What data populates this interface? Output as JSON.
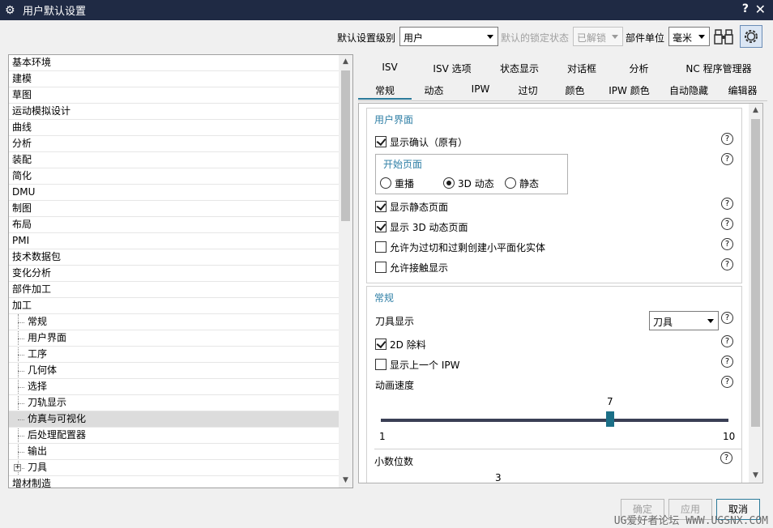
{
  "window": {
    "title": "用户默认设置",
    "help": "?",
    "close": "✕"
  },
  "toolbar": {
    "level_label": "默认设置级别",
    "level_value": "用户",
    "lock_label": "默认的锁定状态",
    "lock_value": "已解锁",
    "unit_label": "部件单位",
    "unit_value": "毫米"
  },
  "tree": {
    "items": [
      "基本环境",
      "建模",
      "草图",
      "运动模拟设计",
      "曲线",
      "分析",
      "装配",
      "简化",
      "DMU",
      "制图",
      "布局",
      "PMI",
      "技术数据包",
      "变化分析",
      "部件加工",
      "加工"
    ],
    "children": [
      "常规",
      "用户界面",
      "工序",
      "几何体",
      "选择",
      "刀轨显示",
      "仿真与可视化",
      "后处理配置器",
      "输出",
      "刀具"
    ],
    "after": [
      "增材制造"
    ],
    "selected": "仿真与可视化"
  },
  "tabs": {
    "row1": [
      "ISV",
      "ISV 选项",
      "状态显示",
      "对话框",
      "分析",
      "NC 程序管理器"
    ],
    "row2": [
      "常规",
      "动态",
      "IPW",
      "过切",
      "颜色",
      "IPW 颜色",
      "自动隐藏",
      "编辑器"
    ],
    "active": "常规"
  },
  "ui_section": {
    "title": "用户界面",
    "show_confirm": "显示确认（原有）",
    "start_page_title": "开始页面",
    "radio_replay": "重播",
    "radio_3d": "3D 动态",
    "radio_static": "静态",
    "selected_radio": "3D 动态",
    "show_static_page": "显示静态页面",
    "show_3d_page": "显示 3D 动态页面",
    "allow_flat_solid": "允许为过切和过剩创建小平面化实体",
    "allow_contact": "允许接触显示"
  },
  "general_section": {
    "title": "常规",
    "tool_display_label": "刀具显示",
    "tool_display_value": "刀具",
    "remove_2d": "2D 除料",
    "show_prev_ipw": "显示上一个 IPW",
    "anim_speed_label": "动画速度",
    "anim_speed_value": "7",
    "anim_min": "1",
    "anim_max": "10",
    "decimals_label": "小数位数",
    "decimals_value": "3"
  },
  "footer": {
    "ok": "确定",
    "apply": "应用",
    "cancel": "取消",
    "watermark": "UG爱好者论坛 WWW.UGSNX.COM"
  },
  "icons": {
    "gear": "gear-icon",
    "binoculars": "binoculars-icon",
    "settings": "settings-gear-icon",
    "help": "help-icon"
  },
  "colors": {
    "titlebar": "#1f2a44",
    "accent": "#2f7fa6",
    "slider_thumb": "#1b6f87"
  }
}
